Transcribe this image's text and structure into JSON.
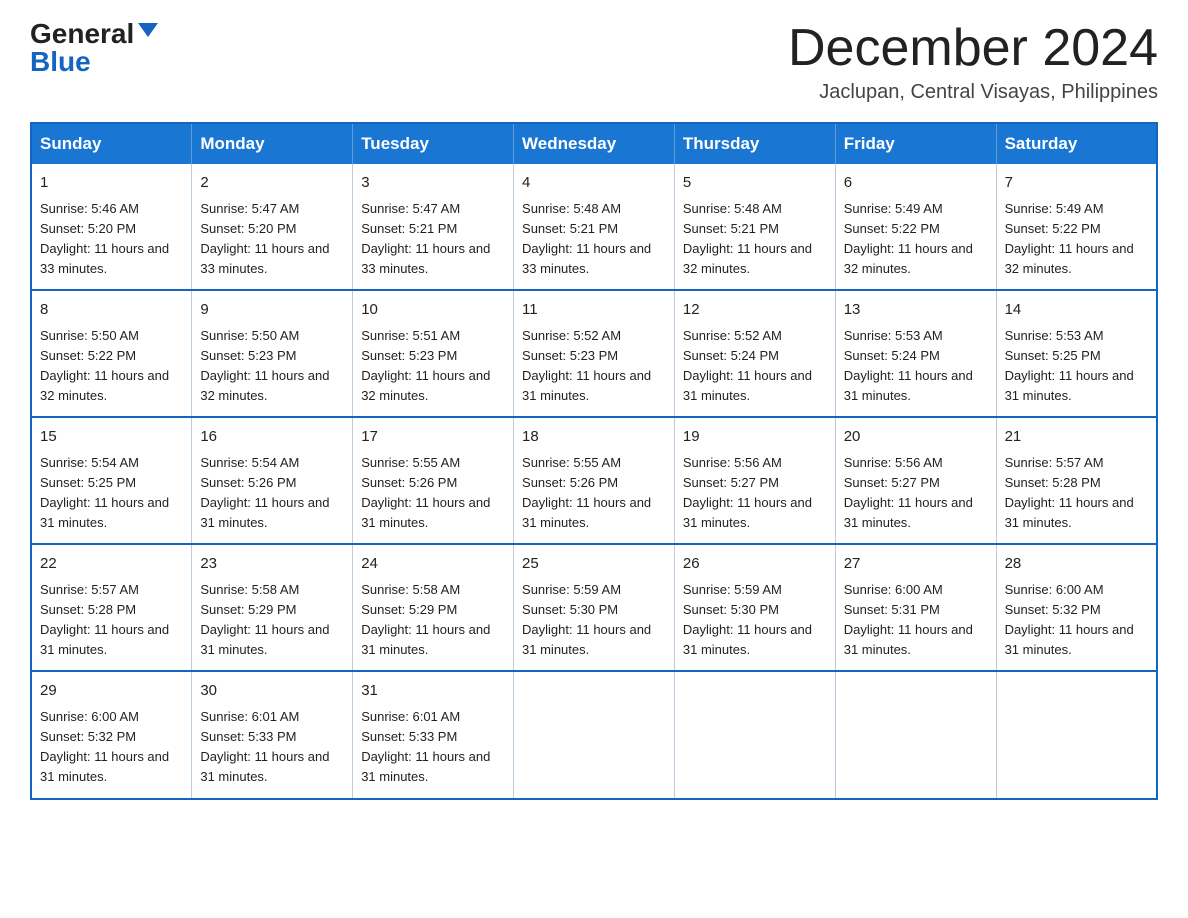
{
  "header": {
    "logo_general": "General",
    "logo_blue": "Blue",
    "month_title": "December 2024",
    "location": "Jaclupan, Central Visayas, Philippines"
  },
  "calendar": {
    "days_of_week": [
      "Sunday",
      "Monday",
      "Tuesday",
      "Wednesday",
      "Thursday",
      "Friday",
      "Saturday"
    ],
    "weeks": [
      [
        {
          "day": "1",
          "sunrise": "5:46 AM",
          "sunset": "5:20 PM",
          "daylight": "11 hours and 33 minutes."
        },
        {
          "day": "2",
          "sunrise": "5:47 AM",
          "sunset": "5:20 PM",
          "daylight": "11 hours and 33 minutes."
        },
        {
          "day": "3",
          "sunrise": "5:47 AM",
          "sunset": "5:21 PM",
          "daylight": "11 hours and 33 minutes."
        },
        {
          "day": "4",
          "sunrise": "5:48 AM",
          "sunset": "5:21 PM",
          "daylight": "11 hours and 33 minutes."
        },
        {
          "day": "5",
          "sunrise": "5:48 AM",
          "sunset": "5:21 PM",
          "daylight": "11 hours and 32 minutes."
        },
        {
          "day": "6",
          "sunrise": "5:49 AM",
          "sunset": "5:22 PM",
          "daylight": "11 hours and 32 minutes."
        },
        {
          "day": "7",
          "sunrise": "5:49 AM",
          "sunset": "5:22 PM",
          "daylight": "11 hours and 32 minutes."
        }
      ],
      [
        {
          "day": "8",
          "sunrise": "5:50 AM",
          "sunset": "5:22 PM",
          "daylight": "11 hours and 32 minutes."
        },
        {
          "day": "9",
          "sunrise": "5:50 AM",
          "sunset": "5:23 PM",
          "daylight": "11 hours and 32 minutes."
        },
        {
          "day": "10",
          "sunrise": "5:51 AM",
          "sunset": "5:23 PM",
          "daylight": "11 hours and 32 minutes."
        },
        {
          "day": "11",
          "sunrise": "5:52 AM",
          "sunset": "5:23 PM",
          "daylight": "11 hours and 31 minutes."
        },
        {
          "day": "12",
          "sunrise": "5:52 AM",
          "sunset": "5:24 PM",
          "daylight": "11 hours and 31 minutes."
        },
        {
          "day": "13",
          "sunrise": "5:53 AM",
          "sunset": "5:24 PM",
          "daylight": "11 hours and 31 minutes."
        },
        {
          "day": "14",
          "sunrise": "5:53 AM",
          "sunset": "5:25 PM",
          "daylight": "11 hours and 31 minutes."
        }
      ],
      [
        {
          "day": "15",
          "sunrise": "5:54 AM",
          "sunset": "5:25 PM",
          "daylight": "11 hours and 31 minutes."
        },
        {
          "day": "16",
          "sunrise": "5:54 AM",
          "sunset": "5:26 PM",
          "daylight": "11 hours and 31 minutes."
        },
        {
          "day": "17",
          "sunrise": "5:55 AM",
          "sunset": "5:26 PM",
          "daylight": "11 hours and 31 minutes."
        },
        {
          "day": "18",
          "sunrise": "5:55 AM",
          "sunset": "5:26 PM",
          "daylight": "11 hours and 31 minutes."
        },
        {
          "day": "19",
          "sunrise": "5:56 AM",
          "sunset": "5:27 PM",
          "daylight": "11 hours and 31 minutes."
        },
        {
          "day": "20",
          "sunrise": "5:56 AM",
          "sunset": "5:27 PM",
          "daylight": "11 hours and 31 minutes."
        },
        {
          "day": "21",
          "sunrise": "5:57 AM",
          "sunset": "5:28 PM",
          "daylight": "11 hours and 31 minutes."
        }
      ],
      [
        {
          "day": "22",
          "sunrise": "5:57 AM",
          "sunset": "5:28 PM",
          "daylight": "11 hours and 31 minutes."
        },
        {
          "day": "23",
          "sunrise": "5:58 AM",
          "sunset": "5:29 PM",
          "daylight": "11 hours and 31 minutes."
        },
        {
          "day": "24",
          "sunrise": "5:58 AM",
          "sunset": "5:29 PM",
          "daylight": "11 hours and 31 minutes."
        },
        {
          "day": "25",
          "sunrise": "5:59 AM",
          "sunset": "5:30 PM",
          "daylight": "11 hours and 31 minutes."
        },
        {
          "day": "26",
          "sunrise": "5:59 AM",
          "sunset": "5:30 PM",
          "daylight": "11 hours and 31 minutes."
        },
        {
          "day": "27",
          "sunrise": "6:00 AM",
          "sunset": "5:31 PM",
          "daylight": "11 hours and 31 minutes."
        },
        {
          "day": "28",
          "sunrise": "6:00 AM",
          "sunset": "5:32 PM",
          "daylight": "11 hours and 31 minutes."
        }
      ],
      [
        {
          "day": "29",
          "sunrise": "6:00 AM",
          "sunset": "5:32 PM",
          "daylight": "11 hours and 31 minutes."
        },
        {
          "day": "30",
          "sunrise": "6:01 AM",
          "sunset": "5:33 PM",
          "daylight": "11 hours and 31 minutes."
        },
        {
          "day": "31",
          "sunrise": "6:01 AM",
          "sunset": "5:33 PM",
          "daylight": "11 hours and 31 minutes."
        },
        null,
        null,
        null,
        null
      ]
    ]
  }
}
